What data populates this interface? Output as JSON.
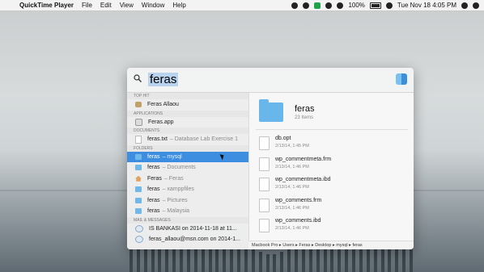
{
  "menubar": {
    "app": "QuickTime Player",
    "menus": [
      "File",
      "Edit",
      "View",
      "Window",
      "Help"
    ],
    "battery": "100%",
    "datetime": "Tue Nov 18  4:05 PM"
  },
  "spotlight": {
    "query": "feras",
    "sections": {
      "top_hit": "TOP HIT",
      "applications": "APPLICATIONS",
      "documents": "DOCUMENTS",
      "folders": "FOLDERS",
      "mail": "MAIL & MESSAGES"
    },
    "top_hit": {
      "label": "Feras Allaou"
    },
    "applications": [
      {
        "label": "Feras.app"
      }
    ],
    "documents": [
      {
        "label": "feras.txt",
        "sub": "– Database Lab Exercise 1"
      }
    ],
    "folders": [
      {
        "label": "feras",
        "sub": "– mysql"
      },
      {
        "label": "feras",
        "sub": "– Documents"
      },
      {
        "label": "Feras",
        "sub": "– Feras"
      },
      {
        "label": "feras",
        "sub": "– xamppfiles"
      },
      {
        "label": "feras",
        "sub": "– Pictures"
      },
      {
        "label": "feras",
        "sub": "– Malaysia"
      }
    ],
    "mail": [
      {
        "label": "IS BANKASI  on 2014-11-18 at 11..."
      },
      {
        "label": "feras_allaou@msn.com on 2014-1..."
      }
    ],
    "preview": {
      "name": "feras",
      "count": "23 Items",
      "files": [
        {
          "name": "db.opt",
          "date": "2/13/14, 1:45 PM"
        },
        {
          "name": "wp_commentmeta.frm",
          "date": "2/13/14, 1:46 PM"
        },
        {
          "name": "wp_commentmeta.ibd",
          "date": "2/13/14, 1:46 PM"
        },
        {
          "name": "wp_comments.frm",
          "date": "2/13/14, 1:46 PM"
        },
        {
          "name": "wp_comments.ibd",
          "date": "2/13/14, 1:46 PM"
        }
      ],
      "path": "Macbook Pro ▸ Users ▸ Feras ▸ Desktop ▸ mysql ▸ feras"
    }
  }
}
